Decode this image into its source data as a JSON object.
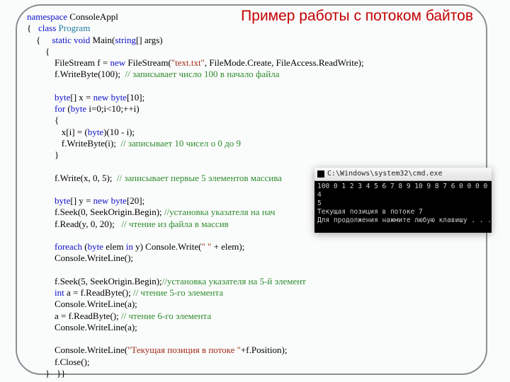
{
  "title": "Пример работы с потоком байтов",
  "code": {
    "ns": "namespace",
    "ns_name": " ConsoleAppl",
    "cls_kw": "class",
    "cls_name": "Program",
    "sv": "static void",
    "main": " Main(",
    "str_t": "string",
    "main2": "[] args)",
    "l1a": "            FileStream f = ",
    "new": "new",
    "l1b": " FileStream(",
    "txt": "\"text.txt\"",
    "l1c": ", FileMode.Create, FileAccess.ReadWrite);",
    "l2": "            f.WriteByte(100);  ",
    "c2": "// записывает число 100 в начало файла",
    "l3a": "            ",
    "byte": "byte",
    "l3b": "[] x = ",
    "l3c": "[10];",
    "l4a": "            ",
    "for": "for",
    "l4b": " (",
    "l4c": " i=0;i<10;++i)",
    "l5": "            {",
    "l6a": "               x[i] = (",
    "l6b": ")(10 - i);",
    "l7a": "               f.WriteByte(i);  ",
    "c7": "// записывает 10 чисел о 0 до 9",
    "l8": "            }",
    "l9": "            f.Write(x, 0, 5);  ",
    "c9": "// записывает первые 5 элементов массива",
    "l10b": "[] y = ",
    "l10c": "[20];",
    "l11": "            f.Seek(0, SeekOrigin.Begin); ",
    "c11": "//установка указателя на нач",
    "l12": "            f.Read(y, 0, 20);   ",
    "c12": "// чтение из файла в массив",
    "fe": "foreach",
    "in": "in",
    "l13a": " (",
    "l13b": " elem ",
    "l13c": " y) Console.Write(",
    "sp": "\" \"",
    "l13d": " + elem);",
    "l14": "            Console.WriteLine();",
    "l15": "            f.Seek(5, SeekOrigin.Begin);",
    "c15": "//установка указателя на 5-й элемент",
    "int": "int",
    "l16a": " a = f.ReadByte(); ",
    "c16": "// чтение 5-го элемента",
    "l17": "            Console.WriteLine(a);",
    "l18a": "            a = f.ReadByte(); ",
    "c18": "// чтение 6-го элемента",
    "l19a": "            Console.WriteLine(",
    "pos": "\"Текущая позиция в потоке \"",
    "l19b": "+f.Position);",
    "l20": "            f.Close();",
    "l21": "        }   }}"
  },
  "console": {
    "title": "C:\\Windows\\system32\\cmd.exe",
    "line1": " 100 0 1 2 3 4 5 6 7 8 9 10 9 8 7 6 0 0 0 0",
    "line2": "4",
    "line3": "5",
    "line4": "Текущая позиция в потоке 7",
    "line5": "Для продолжения нажмите любую клавишу . . ."
  }
}
